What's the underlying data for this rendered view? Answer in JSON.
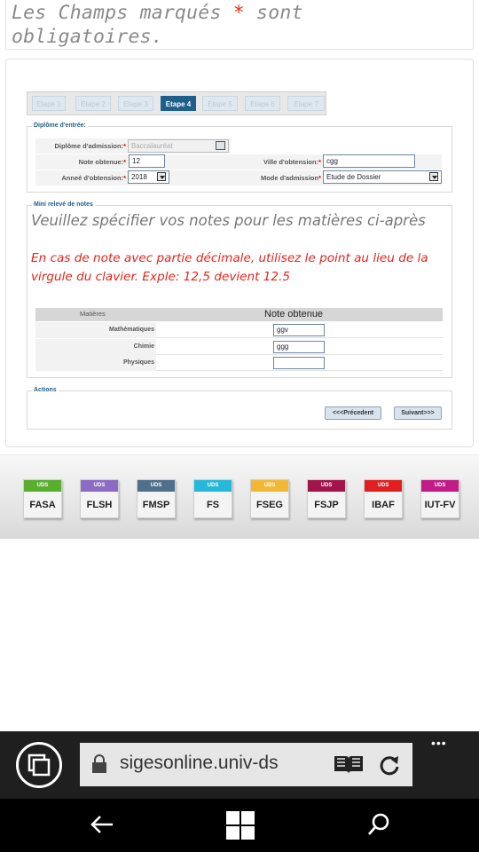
{
  "notice": {
    "prefix": "Les Champs marqués ",
    "star": "*",
    "suffix": " sont obligatoires."
  },
  "steps": [
    "Etape 1",
    "Etape 2",
    "Etape 3",
    "Etape 4",
    "Etape 5",
    "Etape 6",
    "Etape 7"
  ],
  "active_step": "Etape 4",
  "diploma": {
    "legend": "Diplôme d'entrée:",
    "diplome_label": "Diplôme d'admission:",
    "diplome_value": "Baccalauréat",
    "note_label": "Note obtenue:",
    "note_value": "12",
    "annee_label": "Anneé d'obtension:",
    "annee_value": "2018",
    "ville_label": "Ville d'obtension:",
    "ville_value": "cgg",
    "mode_label": "Mode d'admission",
    "mode_value": "Etude de Dossier",
    "required_mark": "*"
  },
  "notes": {
    "legend": "Mini relevé de notes",
    "instruction": "Veuillez spécifier vos notes pour les matières ci-après",
    "warning": "En cas de note avec partie décimale, utilisez le point au lieu de la virgule du clavier. Exple: 12,5 devient 12.5",
    "col_subject": "Matières",
    "col_grade": "Note obtenue",
    "rows": [
      {
        "subject": "Mathématiques",
        "grade": "ggv"
      },
      {
        "subject": "Chimie",
        "grade": "ggg"
      },
      {
        "subject": "Physiques",
        "grade": ""
      }
    ]
  },
  "actions": {
    "legend": "Actions",
    "prev_label": "<<<Précedent",
    "next_label": "Suivant>>>"
  },
  "faculties": [
    {
      "tag": "UDS",
      "name": "FASA",
      "color": "#5aae2e"
    },
    {
      "tag": "UDS",
      "name": "FLSH",
      "color": "#8b6bc4"
    },
    {
      "tag": "UDS",
      "name": "FMSP",
      "color": "#4f6f8c"
    },
    {
      "tag": "UDS",
      "name": "FS",
      "color": "#26b8d8"
    },
    {
      "tag": "UDS",
      "name": "FSEG",
      "color": "#f2b833"
    },
    {
      "tag": "UDS",
      "name": "FSJP",
      "color": "#a3154a"
    },
    {
      "tag": "UDS",
      "name": "IBAF",
      "color": "#e02020"
    },
    {
      "tag": "UDS",
      "name": "IUT-FV",
      "color": "#c21a86"
    }
  ],
  "browser": {
    "url": "sigesonline.univ-ds",
    "more": "•••"
  },
  "icons": {
    "tabs": "tabs-icon",
    "lock": "lock-icon",
    "reading": "reading-view-icon",
    "refresh": "refresh-icon",
    "back": "back-arrow-icon",
    "windows": "windows-logo-icon",
    "search": "search-icon"
  }
}
